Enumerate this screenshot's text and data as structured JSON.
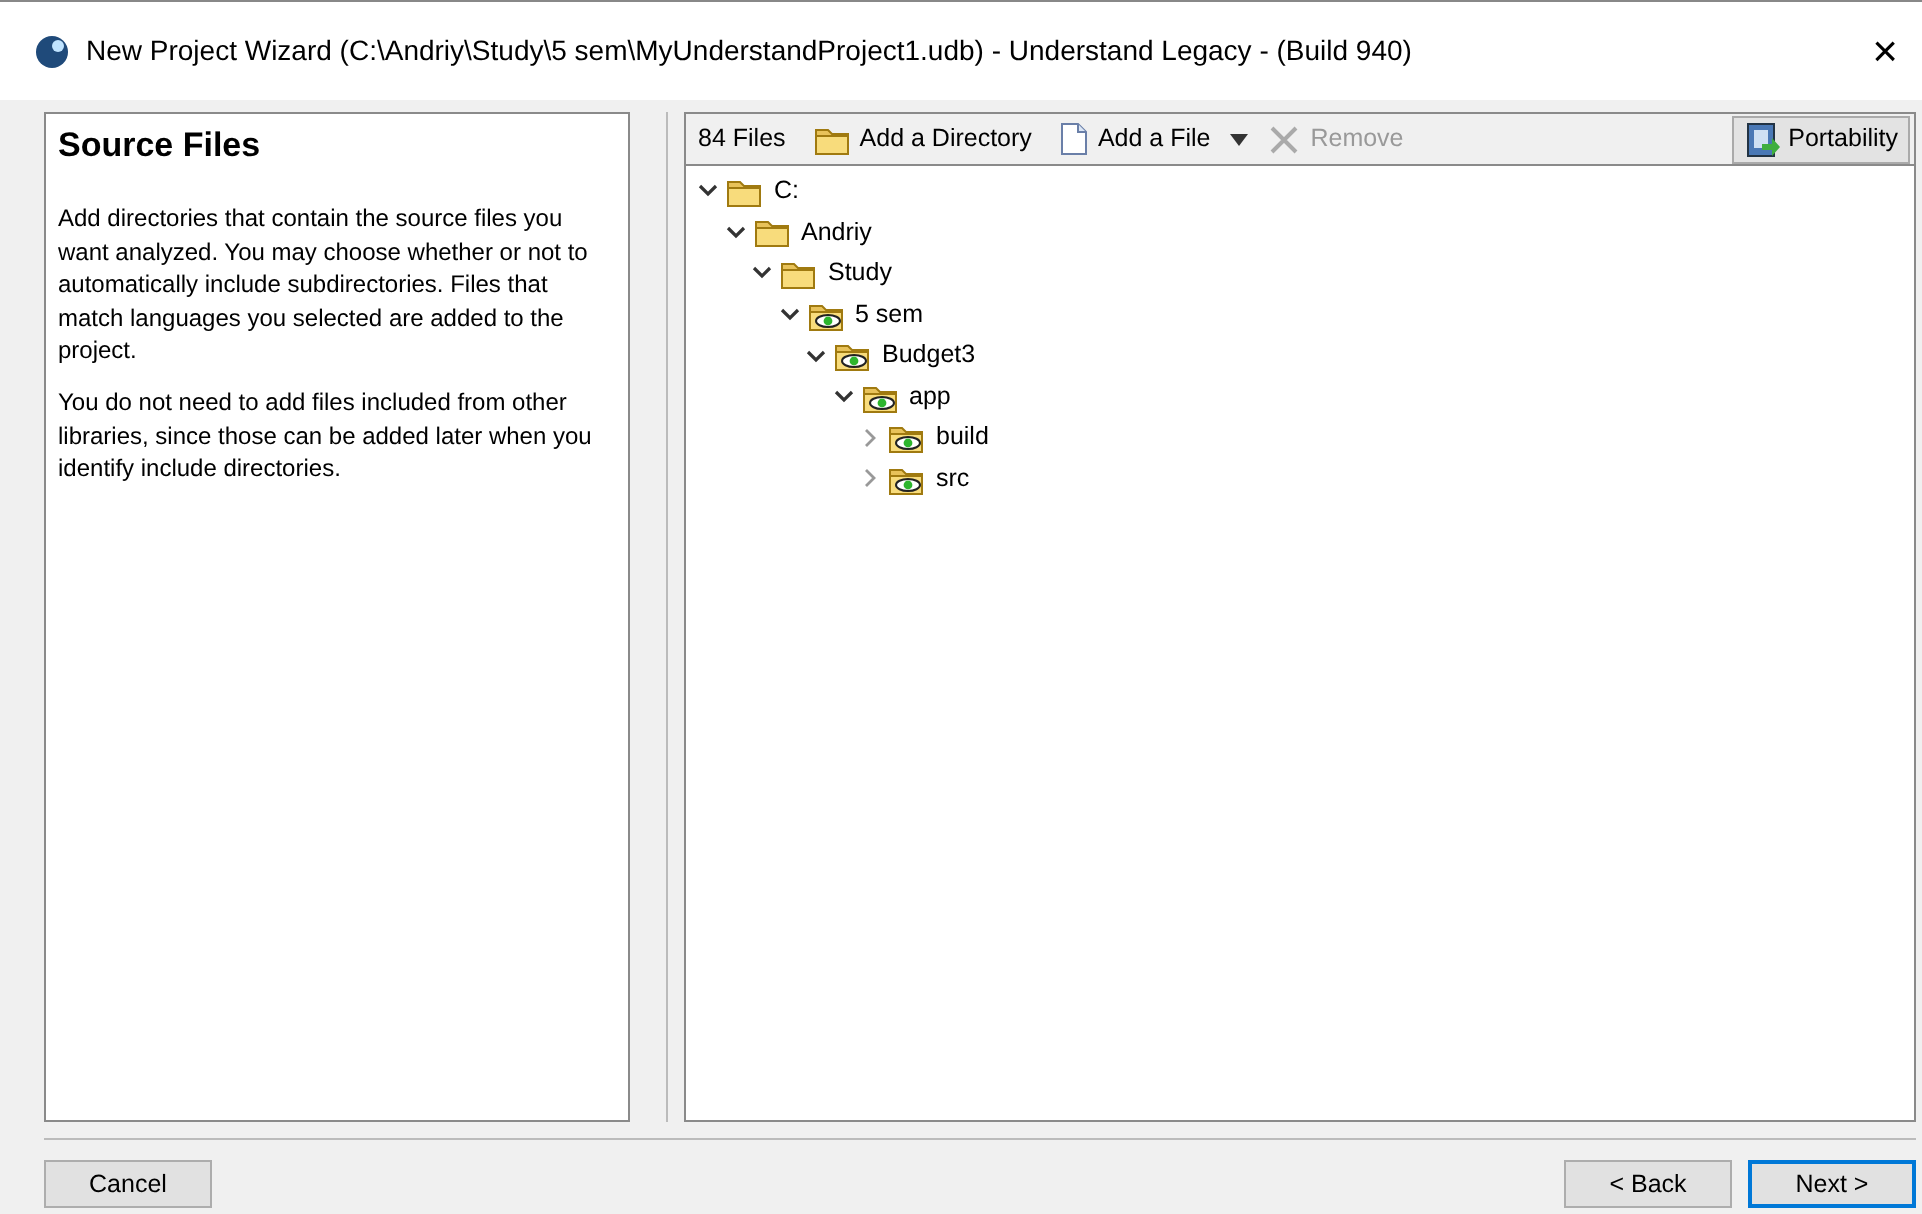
{
  "window": {
    "title": "New Project Wizard (C:\\Andriy\\Study\\5 sem\\MyUnderstandProject1.udb) - Understand Legacy - (Build 940)",
    "close": "×"
  },
  "left_panel": {
    "heading": "Source Files",
    "paragraphs": [
      "Add directories that contain the source files you want analyzed. You may choose whether or not to automatically include subdirectories. Files that match languages you selected are added to the project.",
      "You do not need to add files included from other libraries, since those can be added later when you identify include directories."
    ]
  },
  "toolbar": {
    "file_count": {
      "text": "84 Files"
    },
    "items": [
      {
        "kind": "add-directory",
        "label": "Add a Directory",
        "disabled": false
      },
      {
        "kind": "add-file",
        "label": "Add a File",
        "disabled": false
      },
      {
        "kind": "remove",
        "label": "Remove",
        "disabled": true
      }
    ],
    "portability": {
      "label": "Portability"
    }
  },
  "tree": [
    {
      "label": "C:",
      "kind": "folder",
      "expanded": true,
      "children": [
        {
          "label": "Andriy",
          "kind": "folder",
          "expanded": true,
          "children": [
            {
              "label": "Study",
              "kind": "folder",
              "expanded": true,
              "children": [
                {
                  "label": "5 sem",
                  "kind": "source-folder",
                  "expanded": true,
                  "children": [
                    {
                      "label": "Budget3",
                      "kind": "source-folder",
                      "expanded": true,
                      "children": [
                        {
                          "label": "app",
                          "kind": "source-folder",
                          "expanded": true,
                          "children": [
                            {
                              "label": "build",
                              "kind": "source-folder",
                              "expanded": false
                            },
                            {
                              "label": "src",
                              "kind": "source-folder",
                              "expanded": false
                            }
                          ]
                        }
                      ]
                    }
                  ]
                }
              ]
            }
          ]
        }
      ]
    }
  ],
  "buttons": [
    {
      "label": "Cancel",
      "default": false
    },
    {
      "label": "< Back",
      "default": false
    },
    {
      "label": "Next >",
      "default": true
    }
  ]
}
